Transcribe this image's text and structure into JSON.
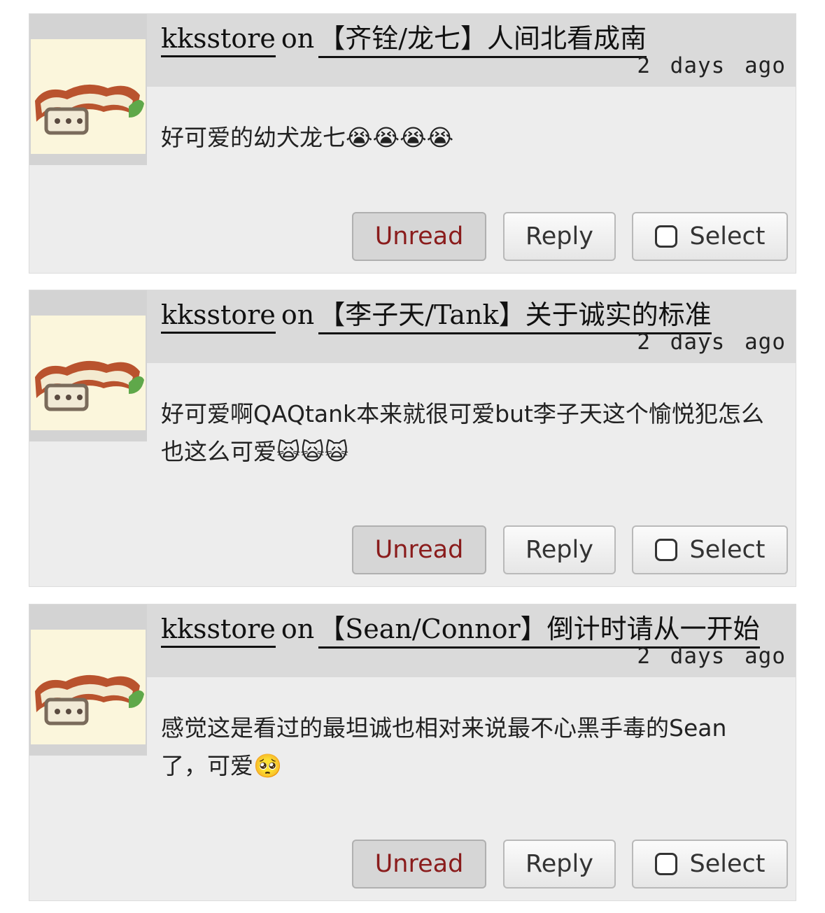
{
  "buttons": {
    "unread": "Unread",
    "reply": "Reply",
    "select": "Select"
  },
  "comments": [
    {
      "user": "kksstore",
      "on": "on",
      "work": "【齐铨/龙七】人间北看成南",
      "time": "2 days ago",
      "text": "好可爱的幼犬龙七😭😭😭😭"
    },
    {
      "user": "kksstore",
      "on": "on",
      "work": "【李子天/Tank】关于诚实的标准",
      "time": "2 days ago",
      "text": "好可爱啊QAQtank本来就很可爱but李子天这个愉悦犯怎么也这么可爱🙀🙀🙀"
    },
    {
      "user": "kksstore",
      "on": "on",
      "work": "【Sean/Connor】倒计时请从一开始",
      "time": "2 days ago",
      "text": "感觉这是看过的最坦诚也相对来说最不心黑手毒的Sean了，可爱🥺"
    }
  ],
  "avatar_icon": "dog-collar-avatar-icon"
}
